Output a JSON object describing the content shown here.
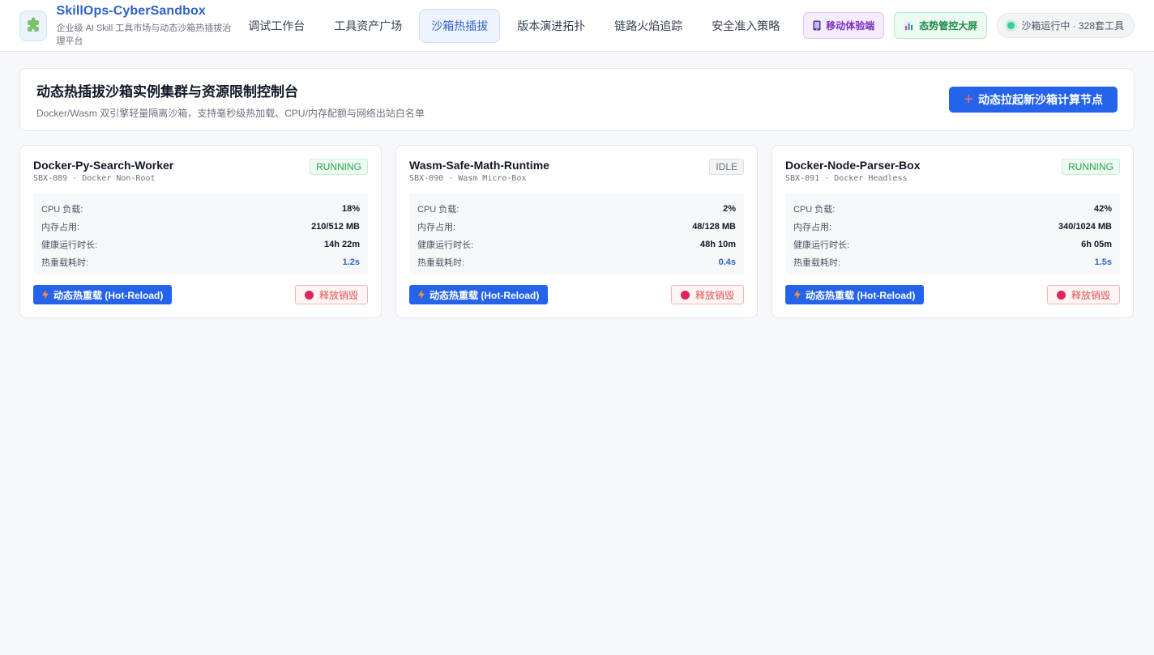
{
  "header": {
    "brand_title": "SkillOps-CyberSandbox",
    "brand_subtitle": "企业级 AI Skill 工具市场与动态沙箱热插拔治理平台",
    "nav": [
      {
        "label": "调试工作台",
        "active": false
      },
      {
        "label": "工具资产广场",
        "active": false
      },
      {
        "label": "沙箱热插拔",
        "active": true
      },
      {
        "label": "版本演进拓扑",
        "active": false
      },
      {
        "label": "链路火焰追踪",
        "active": false
      },
      {
        "label": "安全准入策略",
        "active": false
      }
    ],
    "mobile_label": "移动体验端",
    "screen_label": "态势管控大屏",
    "status_text": "沙箱运行中 · 328套工具"
  },
  "panel": {
    "title": "动态热插拔沙箱实例集群与资源限制控制台",
    "subtitle": "Docker/Wasm 双引擎轻量隔离沙箱，支持毫秒级热加载、CPU/内存配额与网络出站白名单",
    "create_button": "动态拉起新沙箱计算节点"
  },
  "labels": {
    "cpu": "CPU 负载:",
    "memory": "内存占用:",
    "uptime": "健康运行时长:",
    "reload_time": "热重载耗时:",
    "reload_button": "动态热重载 (Hot-Reload)",
    "destroy_button": "释放销毁"
  },
  "sandboxes": [
    {
      "name": "Docker-Py-Search-Worker",
      "meta": "SBX-089 · Docker Non-Root",
      "status": "RUNNING",
      "cpu": "18%",
      "memory": "210/512 MB",
      "uptime": "14h 22m",
      "reload_time": "1.2s"
    },
    {
      "name": "Wasm-Safe-Math-Runtime",
      "meta": "SBX-090 · Wasm Micro-Box",
      "status": "IDLE",
      "cpu": "2%",
      "memory": "48/128 MB",
      "uptime": "48h 10m",
      "reload_time": "0.4s"
    },
    {
      "name": "Docker-Node-Parser-Box",
      "meta": "SBX-091 · Docker Headless",
      "status": "RUNNING",
      "cpu": "42%",
      "memory": "340/1024 MB",
      "uptime": "6h 05m",
      "reload_time": "1.5s"
    }
  ],
  "colors": {
    "brand": "#2f62c9",
    "primary": "#2563eb",
    "running": "#22a350",
    "destroy": "#e05252"
  },
  "icons": {
    "logo": "puzzle-icon",
    "mobile": "phone-icon",
    "screen": "bar-chart-icon",
    "reload": "lightning-icon",
    "create": "plus-icon",
    "destroy": "record-dot-icon"
  }
}
